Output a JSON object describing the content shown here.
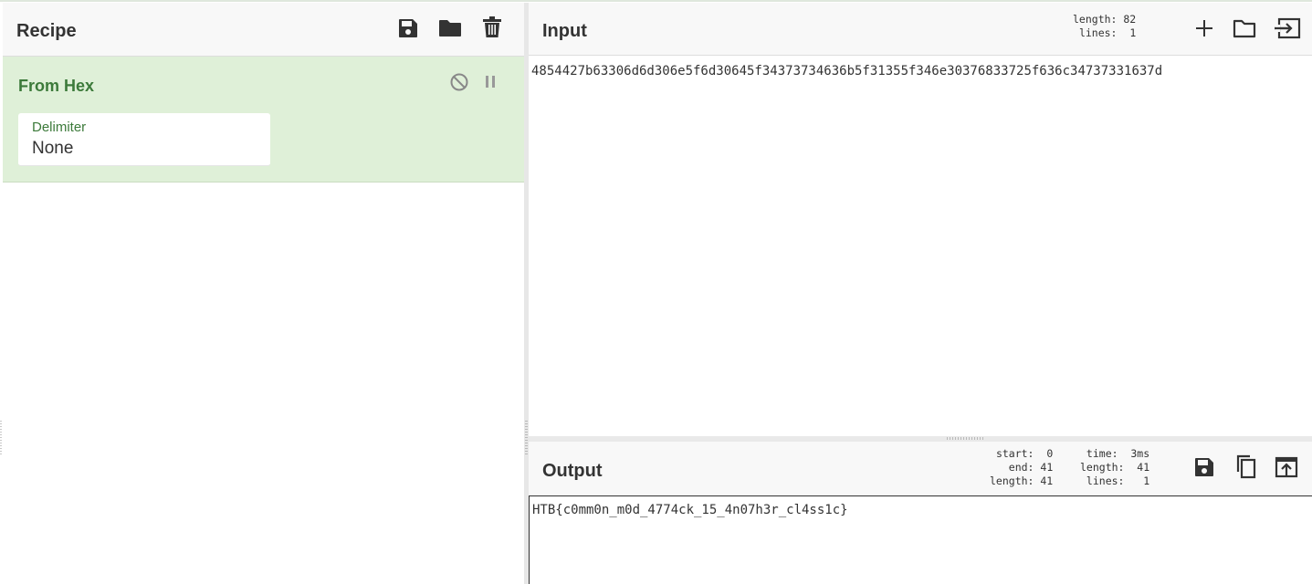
{
  "recipe": {
    "title": "Recipe",
    "icons": [
      "save-icon",
      "folder-icon",
      "trash-icon"
    ],
    "operation": {
      "name": "From Hex",
      "field_label": "Delimiter",
      "field_value": "None",
      "icons": [
        "disable-icon",
        "pause-icon"
      ]
    }
  },
  "input": {
    "title": "Input",
    "stats": "length: 82\nlines:  1",
    "text": "4854427b63306d6d306e5f6d30645f34373734636b5f31355f346e30376833725f636c34737331637d",
    "icons": [
      "plus-icon",
      "folder-icon",
      "input-swap-icon"
    ]
  },
  "output": {
    "title": "Output",
    "stats_left": "start:  0\nend: 41\nlength: 41",
    "stats_right": "time:  3ms\nlength:  41\nlines:   1",
    "text": "HTB{c0mm0n_m0d_4774ck_15_4n07h3r_cl4ss1c}",
    "icons": [
      "save-icon",
      "copy-icon",
      "replace-input-icon"
    ]
  },
  "colors": {
    "operation_bg": "#dff0d8",
    "operation_text": "#3c7a3a",
    "header_bg": "#f8f8f8"
  }
}
